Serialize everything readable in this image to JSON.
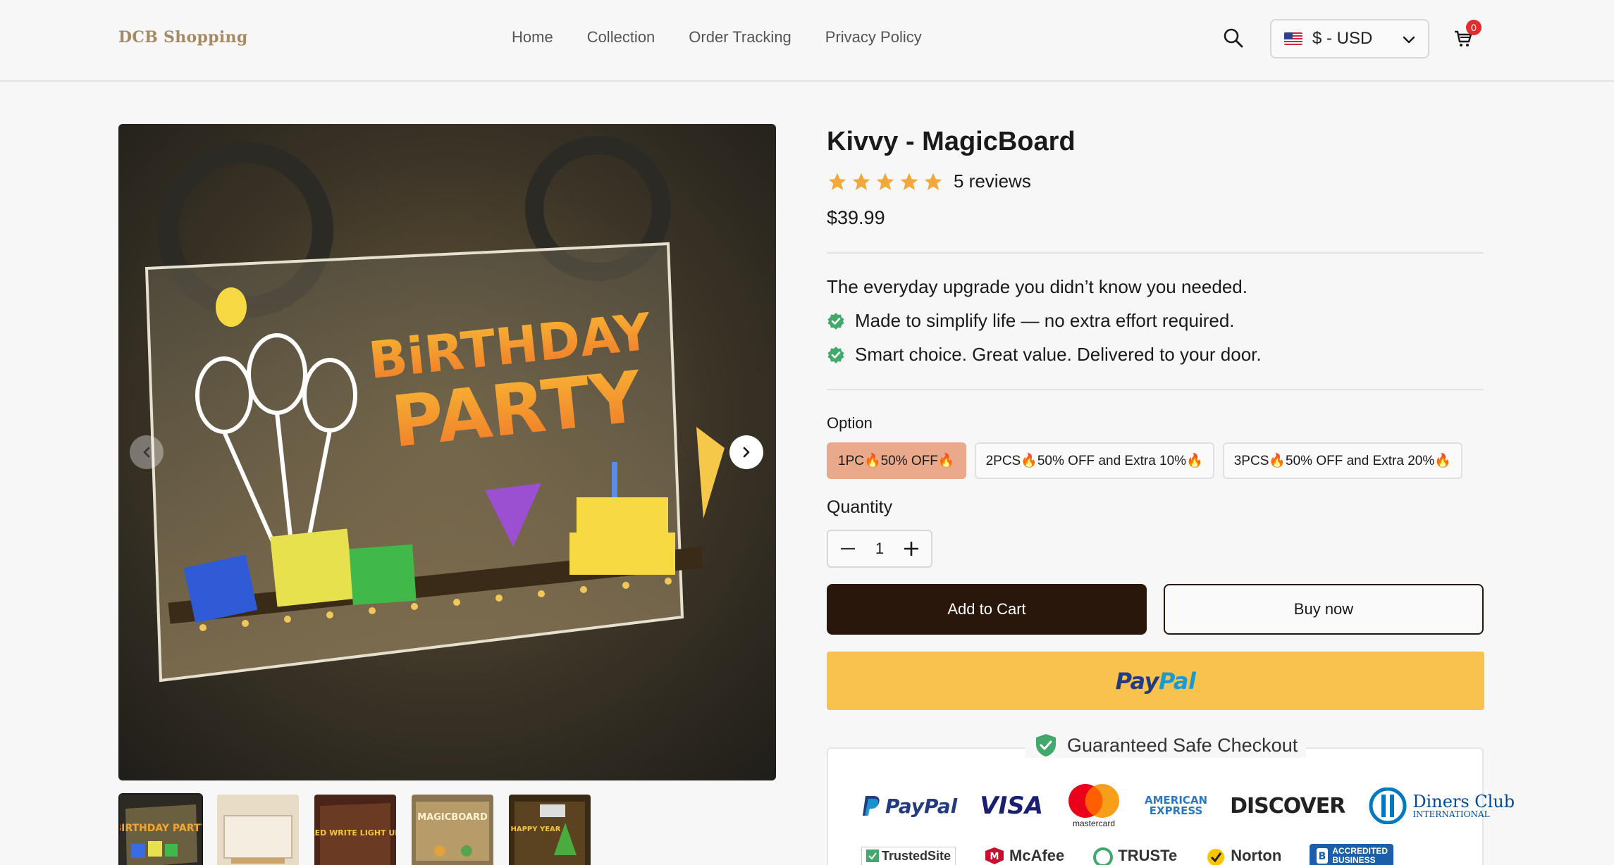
{
  "header": {
    "logo": "DCB Shopping",
    "nav": [
      "Home",
      "Collection",
      "Order Tracking",
      "Privacy Policy"
    ],
    "currency": "$ - USD",
    "cart_count": "0"
  },
  "product": {
    "title": "Kivvy - MagicBoard",
    "rating": 5,
    "reviews": "5 reviews",
    "price": "$39.99",
    "tagline": "The everyday upgrade you didn’t know you needed.",
    "bullets": [
      "Made to simplify life — no extra effort required.",
      "Smart choice. Great value. Delivered to your door."
    ],
    "option_label": "Option",
    "options": [
      "1PC🔥50% OFF🔥",
      "2PCS🔥50% OFF and Extra 10%🔥",
      "3PCS🔥50% OFF and Extra 20%🔥"
    ],
    "selected_option": 0,
    "quantity_label": "Quantity",
    "quantity": "1",
    "add_to_cart": "Add to Cart",
    "buy_now": "Buy now",
    "paypal_a": "Pay",
    "paypal_b": "Pal"
  },
  "image": {
    "headline_1": "BiRTHDAY",
    "headline_2": "PARTY"
  },
  "thumbs": [
    "BIRTHDAY PARTY",
    "",
    "LED WRITE LIGHT UP",
    "MAGICBOARD",
    "HAPPY YEAR"
  ],
  "checkout": {
    "title": "Guaranteed Safe Checkout",
    "payments": {
      "paypal": "PayPal",
      "visa": "VISA",
      "mastercard": "mastercard",
      "amex_1": "AMERICAN",
      "amex_2": "EXPRESS",
      "discover": "DISCOVER",
      "diners_1": "Diners Club",
      "diners_2": "INTERNATIONAL"
    },
    "trust": {
      "trustedsite": "TrustedSite",
      "mcafee": "McAfee",
      "truste": "TRUSTe",
      "norton": "Norton",
      "bbb_1": "ACCREDITED",
      "bbb_2": "BUSINESS"
    }
  },
  "colors": {
    "accent_option": "#eba98b",
    "primary_button": "#2a170c",
    "paypal_button": "#f8c24c",
    "badge": "#e02d2d",
    "check": "#43a86b"
  }
}
